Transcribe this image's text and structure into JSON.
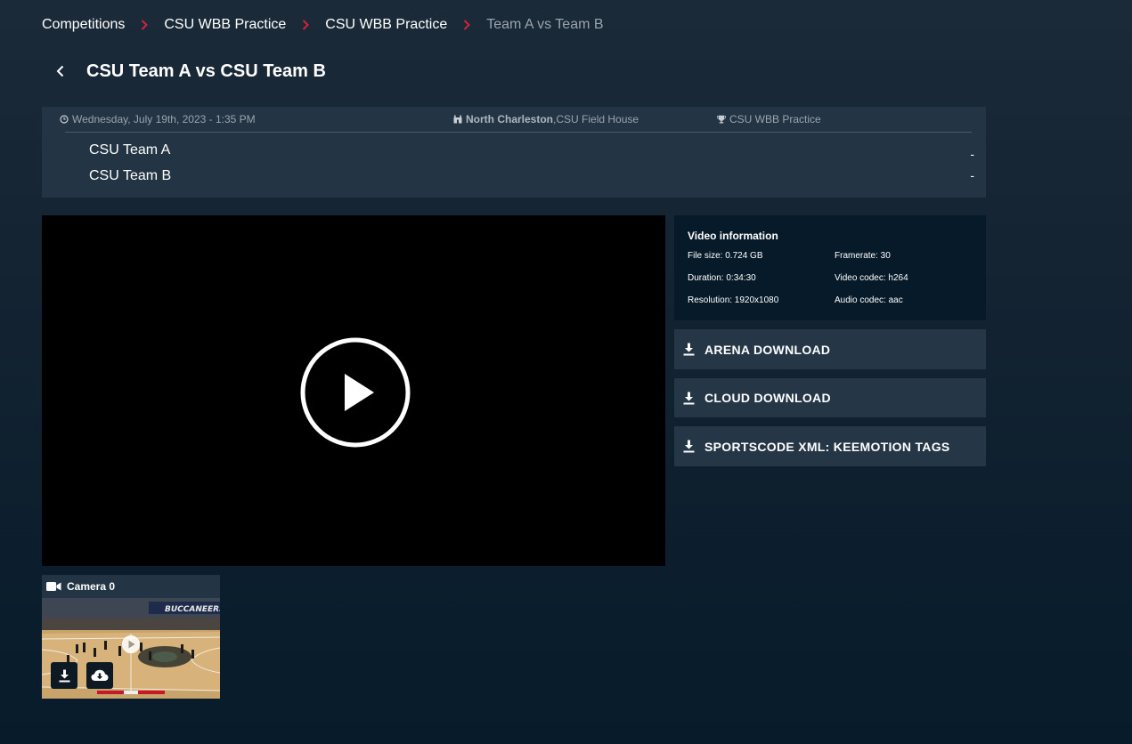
{
  "breadcrumb": {
    "items": [
      "Competitions",
      "CSU WBB Practice",
      "CSU WBB Practice",
      "Team A vs Team B"
    ]
  },
  "header": {
    "title": "CSU Team A vs CSU Team B"
  },
  "match": {
    "datetime": "Wednesday, July 19th, 2023 - 1:35 PM",
    "city": "North Charleston",
    "venue": ",CSU Field House",
    "competition": "CSU WBB Practice",
    "teams": [
      {
        "name": "CSU Team A",
        "score": "-"
      },
      {
        "name": "CSU Team B",
        "score": "-"
      }
    ]
  },
  "video_info": {
    "heading": "Video information",
    "file_size": "File size: 0.724 GB",
    "framerate": "Framerate: 30",
    "duration": "Duration: 0:34:30",
    "video_codec": "Video codec: h264",
    "resolution": "Resolution: 1920x1080",
    "audio_codec": "Audio codec: aac"
  },
  "downloads": {
    "arena": "ARENA DOWNLOAD",
    "cloud": "CLOUD DOWNLOAD",
    "xml": "SPORTSCODE XML: KEEMOTION TAGS"
  },
  "camera": {
    "label": "Camera 0",
    "banner_text": "BUCCANEERS"
  },
  "colors": {
    "accent": "#d2223d",
    "card": "#233545",
    "button": "#253747",
    "panel": "#071a29"
  },
  "icons": [
    "chevron-right-icon",
    "back-arrow-icon",
    "clock-icon",
    "arena-icon",
    "trophy-icon",
    "play-icon",
    "download-icon",
    "cloud-download-icon",
    "camera-icon"
  ]
}
